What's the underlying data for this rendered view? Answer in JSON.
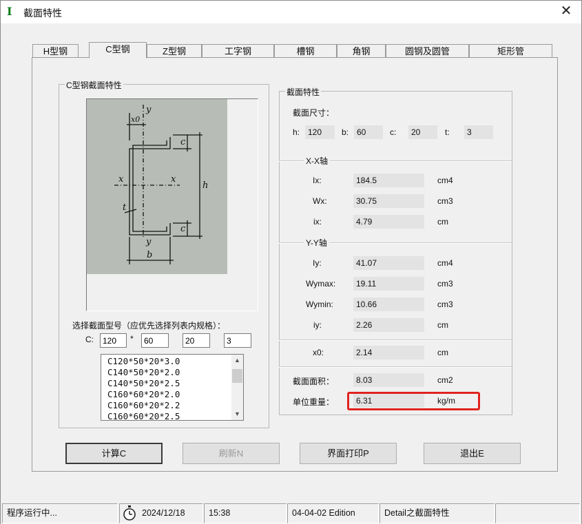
{
  "window": {
    "title": "截面特性",
    "icon": "i-beam-icon",
    "close_icon": "close-icon"
  },
  "tabs": [
    {
      "label": "H型钢",
      "active": false
    },
    {
      "label": "C型钢",
      "active": true
    },
    {
      "label": "Z型钢",
      "active": false
    },
    {
      "label": "工字钢",
      "active": false
    },
    {
      "label": "槽钢",
      "active": false
    },
    {
      "label": "角钢",
      "active": false
    },
    {
      "label": "圆钢及圆管",
      "active": false
    },
    {
      "label": "矩形管",
      "active": false
    }
  ],
  "left_group": {
    "title": "C型钢截面特性",
    "diagram_labels": {
      "y_top": "y",
      "x0": "x0",
      "c_top": "c",
      "x_left": "x",
      "x_right": "x",
      "h": "h",
      "t": "t",
      "c_bottom": "c",
      "y_bottom": "y",
      "b": "b"
    },
    "select_label": "选择截面型号（应优先选择列表内规格）：",
    "c_prefix": "C:",
    "star": "*",
    "inputs": {
      "h": "120",
      "b": "60",
      "c": "20",
      "t": "3"
    },
    "list_items": [
      "C120*50*20*3.0",
      "C140*50*20*2.0",
      "C140*50*20*2.5",
      "C160*60*20*2.0",
      "C160*60*20*2.2",
      "C160*60*20*2.5"
    ]
  },
  "right_group": {
    "title": "截面特性",
    "dims_label": "截面尺寸：",
    "dims": [
      {
        "label": "h:",
        "value": "120"
      },
      {
        "label": "b:",
        "value": "60"
      },
      {
        "label": "c:",
        "value": "20"
      },
      {
        "label": "t:",
        "value": "3"
      }
    ],
    "xx_label": "X-X轴",
    "xx_rows": [
      {
        "label": "Ix:",
        "value": "184.5",
        "unit": "cm4"
      },
      {
        "label": "Wx:",
        "value": "30.75",
        "unit": "cm3"
      },
      {
        "label": "ix:",
        "value": "4.79",
        "unit": "cm"
      }
    ],
    "yy_label": "Y-Y轴",
    "yy_rows": [
      {
        "label": "Iy:",
        "value": "41.07",
        "unit": "cm4"
      },
      {
        "label": "Wymax:",
        "value": "19.11",
        "unit": "cm3"
      },
      {
        "label": "Wymin:",
        "value": "10.66",
        "unit": "cm3"
      },
      {
        "label": "iy:",
        "value": "2.26",
        "unit": "cm"
      }
    ],
    "x0_row": {
      "label": "x0:",
      "value": "2.14",
      "unit": "cm"
    },
    "area_row": {
      "label": "截面面积：",
      "value": "8.03",
      "unit": "cm2"
    },
    "weight_row": {
      "label": "单位重量：",
      "value": "6.31",
      "unit": "kg/m"
    }
  },
  "buttons": {
    "calc": "计算C",
    "refresh": "刷新N",
    "print": "界面打印P",
    "exit": "退出E"
  },
  "status": {
    "state": "程序运行中...",
    "clock_icon": "stopwatch-icon",
    "date": "2024/12/18",
    "time": "15:38",
    "edition": "04-04-02 Edition",
    "detail": "Detail之截面特性"
  }
}
